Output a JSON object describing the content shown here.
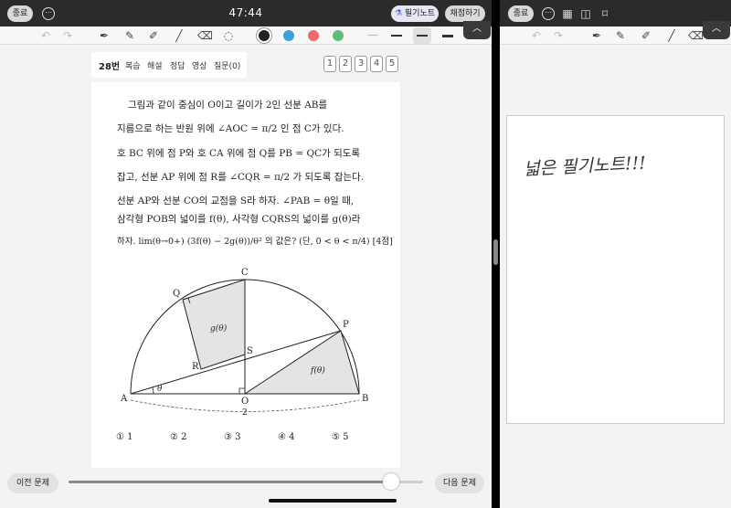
{
  "left_pane": {
    "topbar": {
      "exit_label": "종료",
      "more_icon": "ellipsis-icon",
      "timer": "47:44",
      "note_label": "필기노트",
      "grade_label": "채점하기"
    },
    "toolbar": {
      "icons": [
        "undo-icon",
        "redo-icon",
        "pen-icon",
        "pencil-icon",
        "highlighter-icon",
        "line-icon",
        "eraser-icon",
        "lasso-icon"
      ],
      "colors": [
        "#222222",
        "#3aa0e0",
        "#ef6b6b",
        "#5fbf7a"
      ]
    },
    "question": {
      "number": "28번",
      "tabs": [
        "복습",
        "해설",
        "정답",
        "영상",
        "질문(0)"
      ],
      "pages": [
        "1",
        "2",
        "3",
        "4",
        "5"
      ],
      "lines": [
        "그림과 같이 중심이 O이고 길이가 2인 선분 AB를",
        "지름으로 하는 반원 위에 ∠AOC = π/2 인 점 C가 있다.",
        "호 BC 위에 점 P와 호 CA 위에 점 Q를 PB = QC가 되도록",
        "잡고, 선분 AP 위에 점 R를 ∠CQR = π/2 가 되도록 잡는다.",
        "선분 AP와 선분 CO의 교점을 S라 하자. ∠PAB = θ일 때,",
        "삼각형 POB의 넓이를 f(θ), 사각형 CQRS의 넓이를 g(θ)라",
        "하자. lim(θ→0+) (3f(θ) − 2g(θ))/θ² 의 값은? (단, 0 < θ < π/4) [4점]"
      ],
      "figure_labels": {
        "A": "A",
        "B": "B",
        "C": "C",
        "O": "O",
        "P": "P",
        "Q": "Q",
        "R": "R",
        "S": "S",
        "theta": "θ",
        "g": "g(θ)",
        "f": "f(θ)",
        "two": "2"
      },
      "choices": [
        "① 1",
        "② 2",
        "③ 3",
        "④ 4",
        "⑤ 5"
      ]
    },
    "bottom": {
      "prev_label": "이전 문제",
      "next_label": "다음 문제",
      "progress": 0.91
    }
  },
  "right_pane": {
    "topbar": {
      "exit_label": "종료"
    },
    "handwriting": "넓은 필기노트!!!"
  }
}
